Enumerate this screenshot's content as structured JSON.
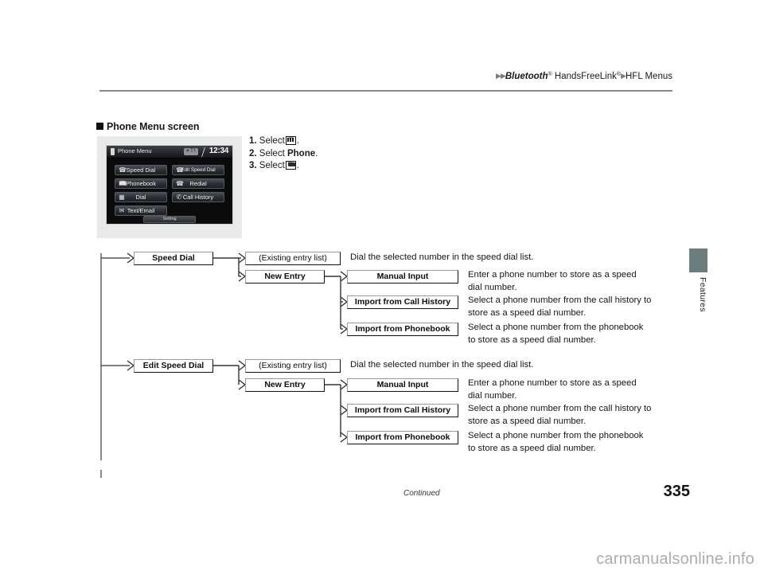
{
  "header": {
    "breadcrumb_part1": "Bluetooth",
    "breadcrumb_reg1": "®",
    "breadcrumb_part2": " HandsFreeLink",
    "breadcrumb_reg2": "®",
    "breadcrumb_part3": "HFL Menus"
  },
  "section": {
    "heading": "Phone Menu screen"
  },
  "nav_screen": {
    "title": "Phone Menu",
    "signal_label": "☀T⸮",
    "clock": "12:34",
    "buttons": [
      {
        "label": "Speed Dial",
        "icon": "phone-speeddial-icon"
      },
      {
        "label": "Edit Speed Dial",
        "icon": "phone-editspeeddial-icon"
      },
      {
        "label": "Phonebook",
        "icon": "phonebook-icon"
      },
      {
        "label": "Redial",
        "icon": "phone-redial-icon"
      },
      {
        "label": "Dial",
        "icon": "keypad-icon"
      },
      {
        "label": "Call History",
        "icon": "call-history-icon"
      },
      {
        "label": "Text/Email",
        "icon": "envelope-icon"
      }
    ],
    "setting_label": "Setting"
  },
  "steps": [
    {
      "num": "1.",
      "verb": "Select",
      "icon": "home-menu-icon",
      "trailing": "."
    },
    {
      "num": "2.",
      "verb": "Select",
      "bold_word": "Phone",
      "trailing": "."
    },
    {
      "num": "3.",
      "verb": "Select",
      "icon": "menu-icon",
      "trailing": "."
    }
  ],
  "flow": {
    "branches": [
      {
        "root": "Speed Dial",
        "items": [
          {
            "label": "(Existing entry list)",
            "bold": false,
            "desc": "Dial the selected number in the speed dial list."
          },
          {
            "label": "New Entry",
            "bold": true,
            "children": [
              {
                "label": "Manual Input",
                "desc": "Enter a phone number to store as a speed\ndial number."
              },
              {
                "label": "Import from Call History",
                "desc": "Select a phone number from the call history to\nstore as a speed dial number."
              },
              {
                "label": "Import from Phonebook",
                "desc": "Select a phone number from the phonebook\nto store as a speed dial number."
              }
            ]
          }
        ]
      },
      {
        "root": "Edit Speed Dial",
        "items": [
          {
            "label": "(Existing entry list)",
            "bold": false,
            "desc": "Dial the selected number in the speed dial list."
          },
          {
            "label": "New Entry",
            "bold": true,
            "children": [
              {
                "label": "Manual Input",
                "desc": "Enter a phone number to store as a speed\ndial number."
              },
              {
                "label": "Import from Call History",
                "desc": "Select a phone number from the call history to\nstore as a speed dial number."
              },
              {
                "label": "Import from Phonebook",
                "desc": "Select a phone number from the phonebook\nto store as a speed dial number."
              }
            ]
          }
        ]
      }
    ]
  },
  "side_tab": {
    "label": "Features",
    "color": "#6b7d7d"
  },
  "footer": {
    "continued": "Continued",
    "page_number": "335"
  },
  "watermark": "carmanualsonline.info"
}
